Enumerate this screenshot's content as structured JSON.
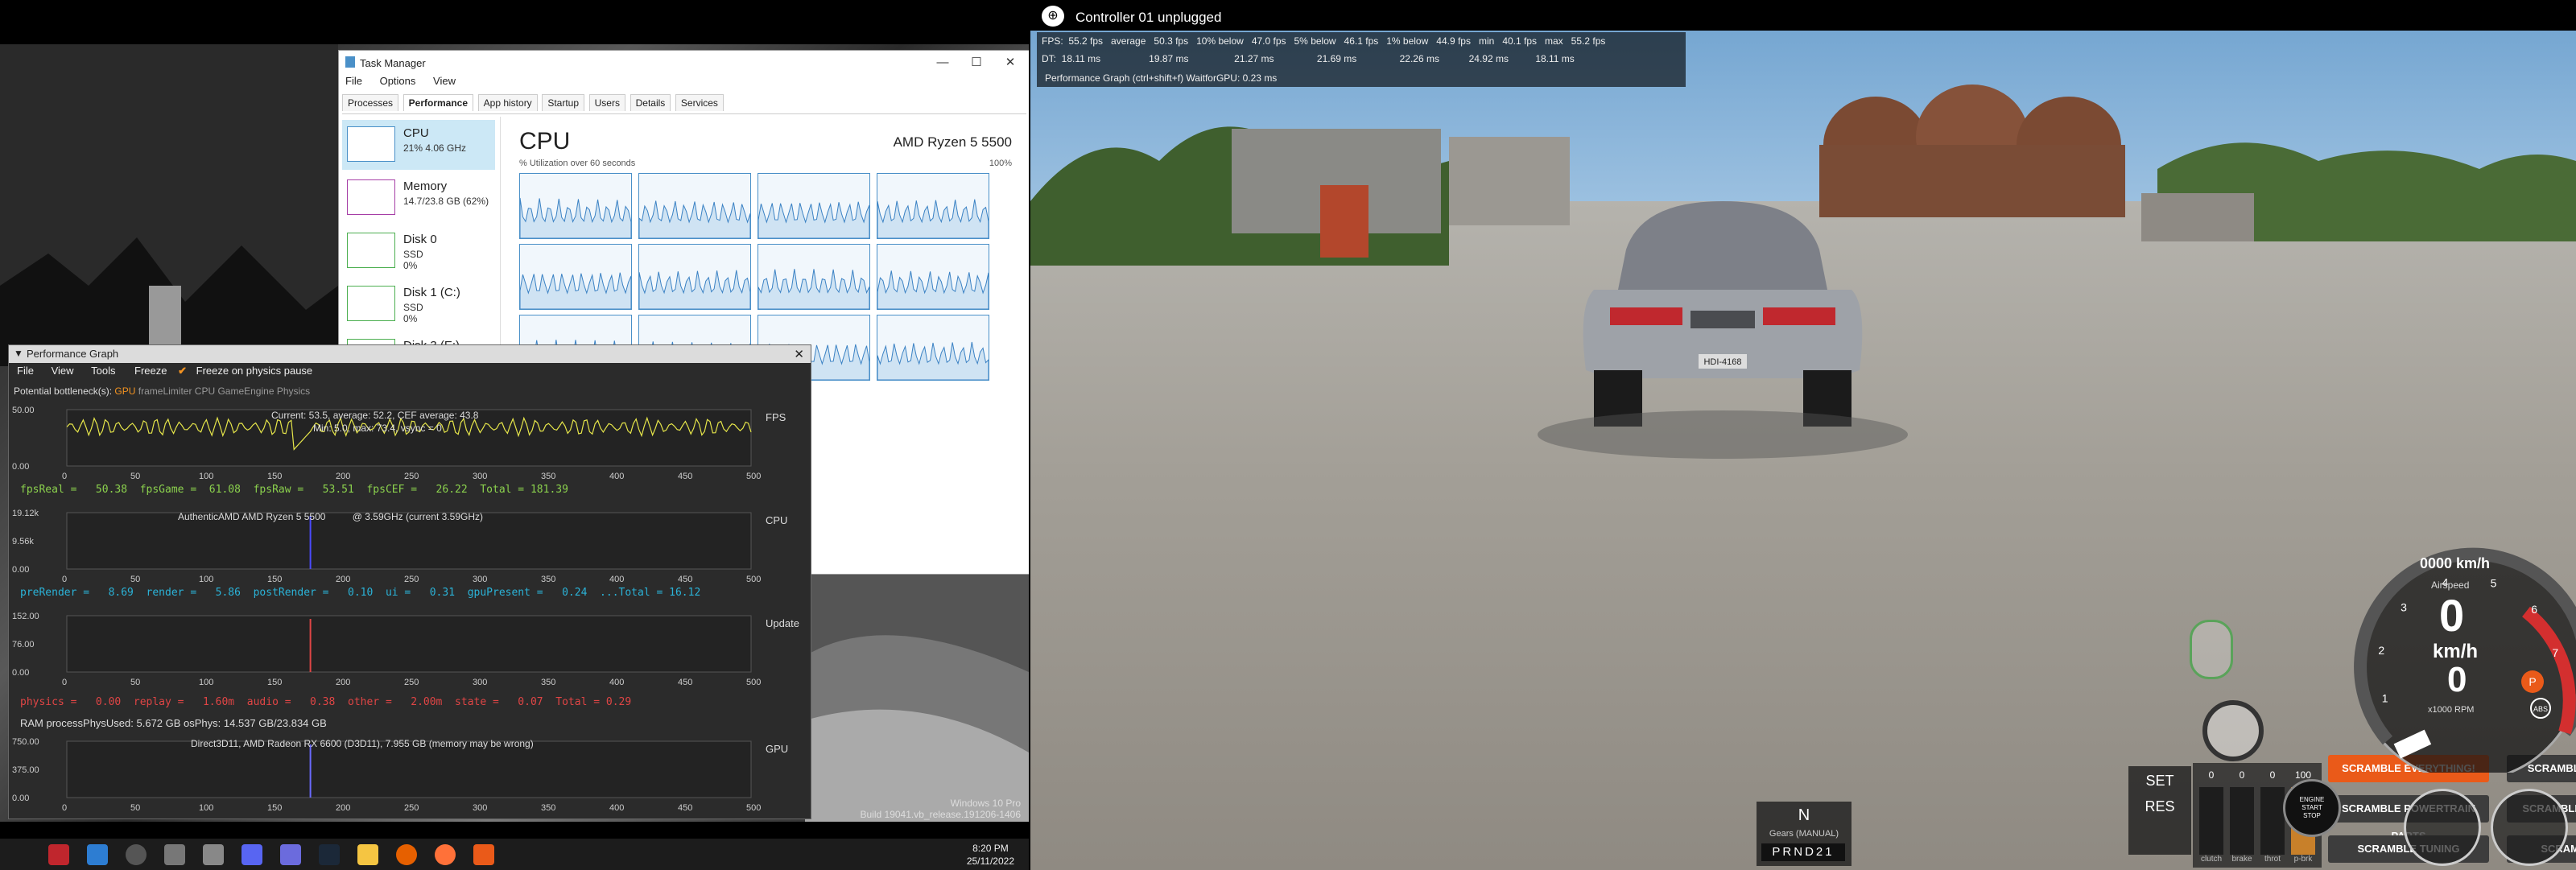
{
  "taskmgr": {
    "title": "Task Manager",
    "menu": [
      "File",
      "Options",
      "View"
    ],
    "tabs": [
      "Processes",
      "Performance",
      "App history",
      "Startup",
      "Users",
      "Details",
      "Services"
    ],
    "side": [
      {
        "name": "CPU",
        "sub": "21% 4.06 GHz",
        "sub2": ""
      },
      {
        "name": "Memory",
        "sub": "14.7/23.8 GB (62%)",
        "sub2": ""
      },
      {
        "name": "Disk 0",
        "sub": "SSD",
        "sub2": "0%"
      },
      {
        "name": "Disk 1 (C:)",
        "sub": "SSD",
        "sub2": "0%"
      },
      {
        "name": "Disk 3 (E:)",
        "sub": "",
        "sub2": ""
      }
    ],
    "cpu_title": "CPU",
    "cpu_model": "AMD Ryzen 5 5500",
    "util_label": "% Utilization over 60 seconds",
    "util_max": "100%"
  },
  "perf": {
    "title": "Performance Graph",
    "menu": [
      "File",
      "View",
      "Tools"
    ],
    "freeze": "Freeze",
    "freeze_physics": "Freeze on physics pause",
    "bottleneck_label": "Potential bottleneck(s):",
    "bottleneck_gpu": "GPU",
    "bottleneck_others": "frameLimiter  CPU  GameEngine  Physics",
    "fps_label": "FPS",
    "fps_ticks": [
      "50.00",
      "0.00"
    ],
    "fps_annot1": "Current: 53.5, average: 52.2, CEF average: 43.8",
    "fps_annot2": "Min: 5.0, max: 73.4, vsync = 0",
    "fps_stats": "fpsReal =   50.38  fpsGame =  61.08  fpsRaw =   53.51  fpsCEF =   26.22  Total = 181.39",
    "cpu_label": "CPU",
    "cpu_ticks": [
      "19.12k",
      "9.56k",
      "0.00"
    ],
    "cpu_annot": "AuthenticAMD AMD Ryzen 5 5500          @ 3.59GHz (current 3.59GHz)",
    "cpu_stats": "preRender =   8.69  render =   5.86  postRender =   0.10  ui =   0.31  gpuPresent =   0.24  ...Total = 16.12",
    "update_label": "Update",
    "update_ticks": [
      "152.00",
      "76.00",
      "0.00"
    ],
    "update_stats": "physics =   0.00  replay =   1.60m  audio =   0.38  other =   2.00m  state =   0.07  Total = 0.29",
    "ram_line": "RAM  processPhysUsed: 5.672 GB  osPhys: 14.537 GB/23.834 GB",
    "gpu_label": "GPU",
    "gpu_ticks": [
      "750.00",
      "375.00",
      "0.00"
    ],
    "gpu_annot": "Direct3D11, AMD Radeon RX 6600 (D3D11), 7.955 GB (memory may be wrong)",
    "x_ticks": [
      "0",
      "50",
      "100",
      "150",
      "200",
      "250",
      "300",
      "350",
      "400",
      "450",
      "500"
    ]
  },
  "desktop": {
    "watermark_1": "Windows 10 Pro",
    "watermark_2": "Build 19041.vb_release.191206-1406",
    "clock_time": "8:20 PM",
    "clock_date": "25/11/2022"
  },
  "game": {
    "controller_msg": "Controller 01 unplugged",
    "fps_row1": "FPS:  55.2 fps   average   50.3 fps   10% below   47.0 fps   5% below   46.1 fps   1% below   44.9 fps   min   40.1 fps   max   55.2 fps",
    "fps_row2": "DT:  18.11 ms                  19.87 ms                 21.27 ms                21.69 ms                22.26 ms           24.92 ms          18.11 ms",
    "perf_hint": "Performance Graph (ctrl+shift+f)   WaitforGPU: 0.23 ms",
    "scramble": {
      "everything": "SCRAMBLE EVERYTHING!",
      "all_parts": "SCRAMBLE ALL PARTS",
      "powertrain": "SCRAMBLE POWERTRAIN PARTS",
      "body": "SCRAMBLE BODY PARTS",
      "tuning": "SCRAMBLE TUNING",
      "paint": "SCRAMBLE PAINT"
    },
    "pedals": [
      {
        "label": "clutch",
        "value": "0"
      },
      {
        "label": "brake",
        "value": "0"
      },
      {
        "label": "throt",
        "value": "0"
      },
      {
        "label": "p-brk",
        "value": "100"
      }
    ],
    "gear": "N",
    "gear_mode": "Gears (MANUAL)",
    "gear_strip": "PRND21",
    "set": "SET",
    "res": "RES",
    "engine": "ENGINE\nSTART\nSTOP",
    "speed_readout": "0000 km/h",
    "airspeed": "Airspeed",
    "speed_value": "0",
    "speed_unit": "km/h",
    "rpm_value": "0",
    "rpm_label": "x1000 RPM",
    "plate": "HDI-4168",
    "rpm_ticks": [
      "1",
      "2",
      "3",
      "4",
      "5",
      "6",
      "7"
    ]
  },
  "colors": {
    "fps_line": "#e6e64a",
    "accent_orange": "#f39321",
    "scramble_orange": "#ea5a19"
  }
}
